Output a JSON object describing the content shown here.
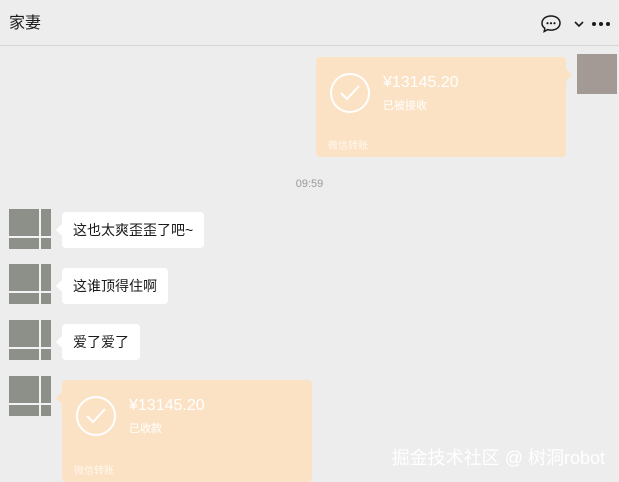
{
  "header": {
    "title": "家妻"
  },
  "icons": {
    "chat": "chat-bubble-icon",
    "chevron": "chevron-down-icon",
    "more": "more-dots-icon",
    "check": "check-circle-icon"
  },
  "colors": {
    "background": "#ededed",
    "transfer_bg": "#fce2c4",
    "bubble_bg": "#ffffff"
  },
  "messages": {
    "transfer_sent": {
      "amount": "¥13145.20",
      "status": "已被接收",
      "footer": "微信转账"
    },
    "timestamp": "09:59",
    "text_1": "这也太爽歪歪了吧~",
    "text_2": "这谁顶得住啊",
    "text_3": "爱了爱了",
    "transfer_received": {
      "amount": "¥13145.20",
      "status": "已收款",
      "footer": "微信转账"
    }
  },
  "watermark": "掘金技术社区 @ 树洞robot"
}
